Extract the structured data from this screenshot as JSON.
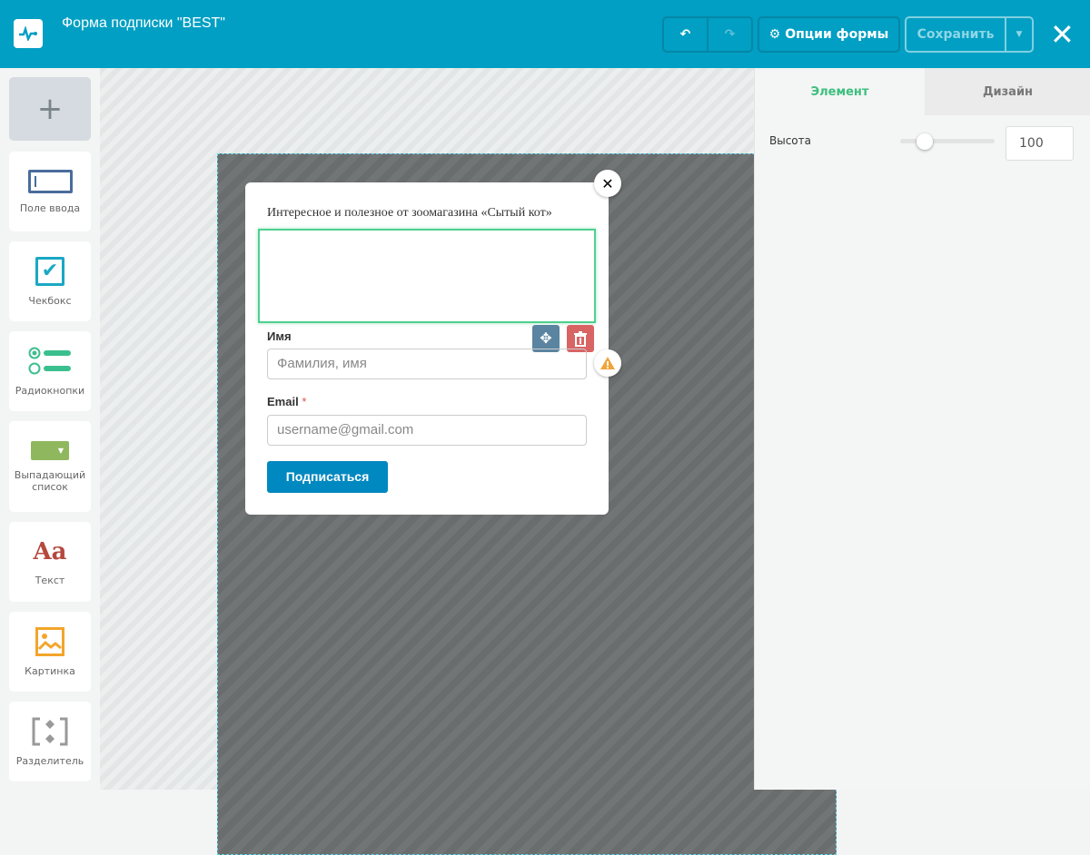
{
  "header": {
    "title": "Форма подписки \"BEST\"",
    "options_label": "Опции формы",
    "save_label": "Сохранить"
  },
  "sidebar": {
    "items": [
      {
        "label": "Поле ввода",
        "icon": "input-field-icon"
      },
      {
        "label": "Чекбокс",
        "icon": "checkbox-icon"
      },
      {
        "label": "Радиокнопки",
        "icon": "radio-icon"
      },
      {
        "label": "Выпадающий список",
        "icon": "dropdown-icon"
      },
      {
        "label": "Текст",
        "icon": "text-icon",
        "glyph": "Aa"
      },
      {
        "label": "Картинка",
        "icon": "image-icon"
      },
      {
        "label": "Разделитель",
        "icon": "divider-icon"
      }
    ]
  },
  "form": {
    "heading": "Интересное и полезное от зоомагазина «Сытый кот»",
    "name_label": "Имя",
    "name_placeholder": "Фамилия, имя",
    "email_label": "Email",
    "required_mark": "*",
    "email_placeholder": "username@gmail.com",
    "submit_label": "Подписаться"
  },
  "panel": {
    "tabs": [
      "Элемент",
      "Дизайн"
    ],
    "height_label": "Высота",
    "height_value": "100",
    "slider_fraction": 0.25
  },
  "colors": {
    "header": "#009fc3",
    "active_tab": "#3cbf7e",
    "selection": "#4fd08e",
    "submit": "#0088c0"
  }
}
